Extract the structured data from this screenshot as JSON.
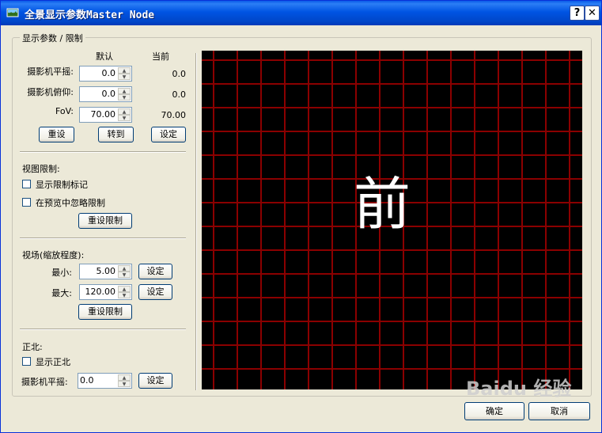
{
  "window": {
    "title": "全景显示参数Master Node",
    "help": "?",
    "close": "✕"
  },
  "display_group": {
    "title": "显示参数 / 限制",
    "col_default": "默认",
    "col_current": "当前",
    "rows": [
      {
        "label": "摄影机平摇:",
        "value": "0.0",
        "current": "0.0"
      },
      {
        "label": "摄影机俯仰:",
        "value": "0.0",
        "current": "0.0"
      },
      {
        "label": "FoV:",
        "value": "70.00",
        "current": "70.00"
      }
    ],
    "buttons": {
      "reset": "重设",
      "goto": "转到",
      "set": "设定"
    }
  },
  "view_limit": {
    "title": "视图限制:",
    "show_marks": "显示限制标记",
    "ignore_preview": "在预览中忽略限制",
    "reset_btn": "重设限制"
  },
  "fov_section": {
    "title": "视场(缩放程度):",
    "min_label": "最小:",
    "min_value": "5.00",
    "max_label": "最大:",
    "max_value": "120.00",
    "set_label": "设定",
    "reset_btn": "重设限制"
  },
  "north": {
    "title": "正北:",
    "show_north": "显示正北",
    "pan_label": "摄影机平摇:",
    "pan_value": "0.0",
    "set_label": "设定"
  },
  "preview": {
    "text": "前",
    "grid_color": "#8b0000",
    "background": "#000000"
  },
  "footer": {
    "ok": "确定",
    "cancel": "取消"
  },
  "watermark": {
    "text": "Baidu 经验"
  },
  "colors": {
    "titlebar": "#0054e3",
    "dialog": "#ece9d8"
  },
  "icons": {
    "app": "panorama-app-icon",
    "spin": "spin-arrows-icon",
    "check": "checkbox-icon"
  }
}
